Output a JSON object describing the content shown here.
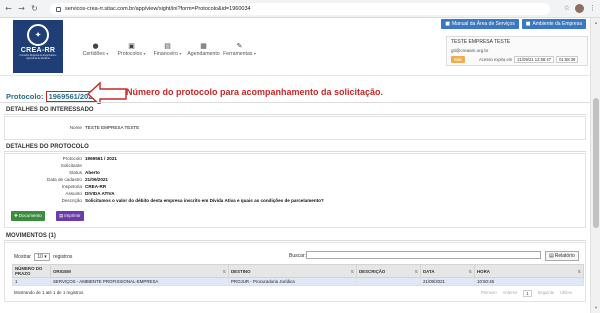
{
  "browser": {
    "url": "servicos-crea-rr.sitac.com.br/app/view/sight/ini?form=Protocolo&id=1960034"
  },
  "logo": {
    "brand": "CREA-RR",
    "subtitle": "Conselho Regional de Engenharia e Agronomia de Roraima"
  },
  "menu": [
    {
      "label": "Certidões",
      "icon": "circle-icon"
    },
    {
      "label": "Protocolos",
      "icon": "briefcase-icon"
    },
    {
      "label": "Financeiro",
      "icon": "money-icon"
    },
    {
      "label": "Agendamento",
      "icon": "calendar-icon"
    },
    {
      "label": "Ferramentas",
      "icon": "wrench-icon"
    }
  ],
  "top_buttons": {
    "manual": "Manual da Área de Serviços",
    "ambiente": "Ambiente da Empresa"
  },
  "user": {
    "name": "TESTE EMPRESA TESTE",
    "email": "gti@creaam.org.br",
    "logout": "Sair",
    "expires_label": "Acesso expira em",
    "expires_date": "21/09/21 12:58:47",
    "expires_time": "01:58:39"
  },
  "protocol": {
    "label": "Protocolo:",
    "number": "1969561/2021",
    "annotation": "Número do protocolo para acompanhamento da solicitação."
  },
  "interessado": {
    "title": "DETALHES DO INTERESSADO",
    "name_label": "Nome",
    "name_value": "TESTE EMPRESA TESTE"
  },
  "detalhes": {
    "title": "DETALHES DO PROTOCOLO",
    "fields": [
      {
        "k": "Protocolo",
        "v": "1969561 / 2021"
      },
      {
        "k": "Solicitante",
        "v": ""
      },
      {
        "k": "Status",
        "v": "Aberto"
      },
      {
        "k": "Data de cadastro",
        "v": "21/09/2021"
      },
      {
        "k": "Inspetoria",
        "v": "CREA-RR"
      },
      {
        "k": "Assunto",
        "v": "DIVIDA ATIVA"
      },
      {
        "k": "Descrição",
        "v": "Solicitamos o valor do débito desta empresa inscrito em Dívida Ativa e quais as condições de parcelamento?"
      }
    ],
    "btn_documento": "Documento",
    "btn_imprimir": "Imprimir"
  },
  "movimentos": {
    "title": "MOVIMENTOS (1)",
    "show_label": "Mostrar",
    "show_value": "10",
    "records_label": "registros",
    "search_label": "Buscar:",
    "report_label": "Relatório",
    "columns": [
      "NÚMERO DO PRAZO",
      "ORIGEM",
      "DESTINO",
      "DESCRIÇÃO",
      "DATA",
      "HORA"
    ],
    "rows": [
      [
        "1",
        "SERVIÇOS - AMBIENTE PROFISSIONAL-EMPRESA",
        "PROJUR - Procuradoria Jurídica",
        "",
        "21/09/2021",
        "10:50:45"
      ]
    ],
    "info": "Mostrando de 1 até 1 de 1 registros",
    "pager": {
      "first": "Primeiro",
      "prev": "Anterior",
      "current": "1",
      "next": "Seguinte",
      "last": "Último"
    }
  }
}
